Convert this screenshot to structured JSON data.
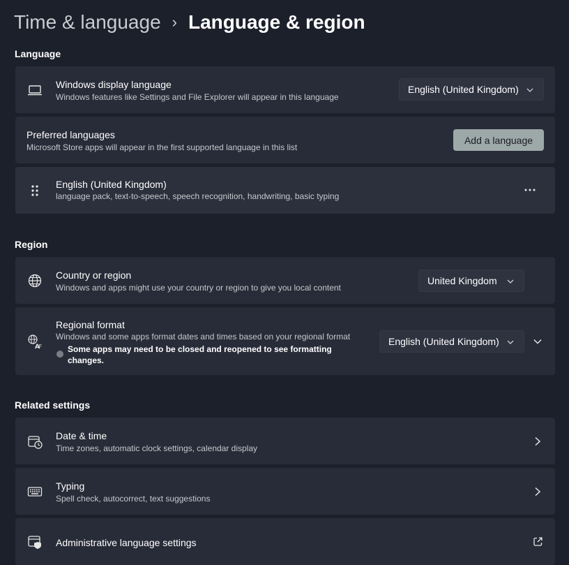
{
  "header": {
    "parent": "Time & language",
    "current": "Language & region"
  },
  "language": {
    "section_title": "Language",
    "display_language": {
      "title": "Windows display language",
      "subtitle": "Windows features like Settings and File Explorer will appear in this language",
      "value": "English (United Kingdom)",
      "icon": "laptop-icon"
    },
    "preferred": {
      "title": "Preferred languages",
      "subtitle": "Microsoft Store apps will appear in the first supported language in this list",
      "button": "Add a language"
    },
    "installed": {
      "title": "English (United Kingdom)",
      "subtitle": "language pack, text-to-speech, speech recognition, handwriting, basic typing",
      "icon": "drag-handle-icon"
    }
  },
  "region": {
    "section_title": "Region",
    "country": {
      "title": "Country or region",
      "subtitle": "Windows and apps might use your country or region to give you local content",
      "value": "United Kingdom",
      "icon": "globe-icon"
    },
    "format": {
      "title": "Regional format",
      "subtitle": "Windows and some apps format dates and times based on your regional format",
      "note_line1": "Some apps may need to be closed and reopened to see formatting",
      "note_line2": "changes.",
      "value": "English (United Kingdom)",
      "icon": "regional-format-icon"
    }
  },
  "related": {
    "section_title": "Related settings",
    "date_time": {
      "title": "Date & time",
      "subtitle": "Time zones, automatic clock settings, calendar display",
      "icon": "calendar-clock-icon"
    },
    "typing": {
      "title": "Typing",
      "subtitle": "Spell check, autocorrect, text suggestions",
      "icon": "keyboard-icon"
    },
    "admin": {
      "title": "Administrative language settings",
      "icon": "admin-window-icon"
    }
  },
  "colors": {
    "background": "#1c202b",
    "card": "#282c38",
    "button": "#9da8a9"
  }
}
